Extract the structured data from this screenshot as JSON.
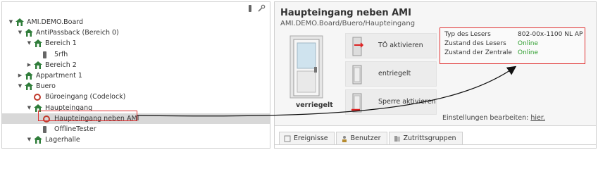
{
  "toolbar": {
    "icons": [
      "tester-icon",
      "wrench-icon"
    ]
  },
  "tree": [
    {
      "label": "AMI.DEMO.Board",
      "icon": "building-icon",
      "toggle": "▼",
      "level": 0
    },
    {
      "label": "AntiPassback (Bereich 0)",
      "icon": "building-icon",
      "toggle": "▼",
      "level": 1
    },
    {
      "label": "Bereich 1",
      "icon": "building-icon",
      "toggle": "▼",
      "level": 2
    },
    {
      "label": "5rfh",
      "icon": "tester-icon",
      "toggle": "",
      "level": 3
    },
    {
      "label": "Bereich 2",
      "icon": "building-icon",
      "toggle": "▶",
      "level": 2
    },
    {
      "label": "Appartment 1",
      "icon": "building-icon",
      "toggle": "▶",
      "level": 1
    },
    {
      "label": "Buero",
      "icon": "building-icon",
      "toggle": "▼",
      "level": 1
    },
    {
      "label": "Büroeingang (Codelock)",
      "icon": "door-icon",
      "toggle": "",
      "level": 2
    },
    {
      "label": "Haupteingang",
      "icon": "building-icon",
      "toggle": "▼",
      "level": 2
    },
    {
      "label": "Haupteingang neben AMI",
      "icon": "door-icon",
      "toggle": "",
      "level": 3,
      "selected": true
    },
    {
      "label": "OfflineTester",
      "icon": "tester-icon",
      "toggle": "",
      "level": 3
    },
    {
      "label": "Lagerhalle",
      "icon": "building-icon",
      "toggle": "▼",
      "level": 2
    }
  ],
  "detail": {
    "title": "Haupteingang neben AMI",
    "path": "AMI.DEMO.Board/Buero/Haupteingang",
    "door_state": "verriegelt",
    "actions": [
      {
        "label": "TÖ aktivieren",
        "icon": "door-open-red-icon"
      },
      {
        "label": "entriegelt",
        "icon": "door-unlocked-icon"
      },
      {
        "label": "Sperre aktivieren",
        "icon": "door-locked-red-icon"
      }
    ],
    "info": [
      {
        "key": "Typ des Lesers",
        "value": "802-00x-1100 NL AP",
        "status": ""
      },
      {
        "key": "Zustand des Lesers",
        "value": "Online",
        "status": "ok"
      },
      {
        "key": "Zustand der Zentrale",
        "value": "Online",
        "status": "ok"
      }
    ],
    "settings_text": "Einstellungen bearbeiten:",
    "settings_link": "hier.",
    "tabs": [
      {
        "label": "Ereignisse",
        "icon": "event-icon"
      },
      {
        "label": "Benutzer",
        "icon": "user-icon"
      },
      {
        "label": "Zutrittsgruppen",
        "icon": "group-icon"
      }
    ]
  },
  "colors": {
    "accent_red": "#e03131",
    "online_green": "#2e9e2e",
    "selection_bg": "#d8d8d8",
    "building_green": "#2f7d3a"
  }
}
